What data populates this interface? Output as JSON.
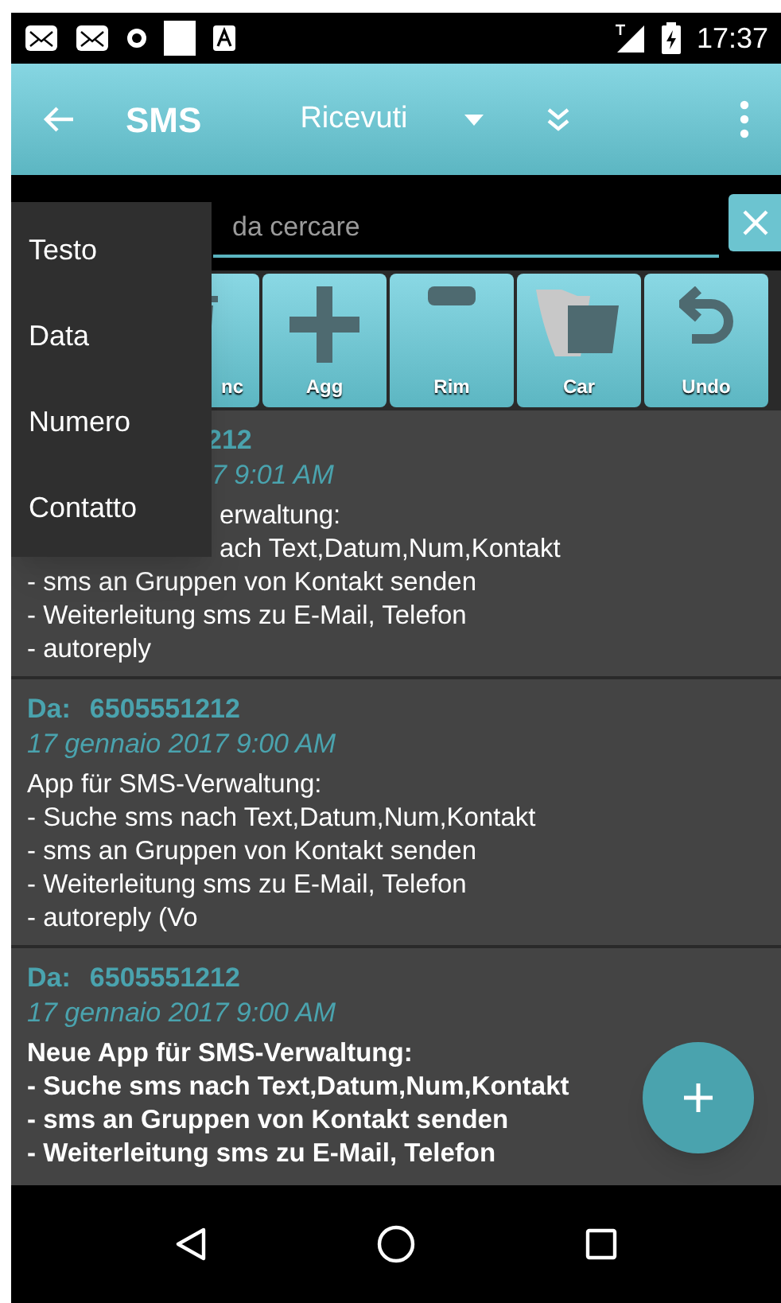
{
  "status_bar": {
    "time": "17:37"
  },
  "app_bar": {
    "title": "SMS",
    "folder": "Ricevuti"
  },
  "search": {
    "placeholder": "da cercare"
  },
  "toolbar": [
    {
      "kind": "delete",
      "label": "nc"
    },
    {
      "kind": "add",
      "label": "Agg"
    },
    {
      "kind": "remove",
      "label": "Rim"
    },
    {
      "kind": "folder",
      "label": "Car"
    },
    {
      "kind": "undo",
      "label": "Undo"
    }
  ],
  "menu": [
    {
      "label": "Testo"
    },
    {
      "label": "Data"
    },
    {
      "label": "Numero"
    },
    {
      "label": "Contatto"
    }
  ],
  "messages": [
    {
      "number_tail": "212",
      "date_tail": "7 9:01 AM",
      "bold": false,
      "tail_lines": [
        "erwaltung:",
        "ach Text,Datum,Num,Kontakt"
      ],
      "lines": [
        "- sms an Gruppen von Kontakt senden",
        "- Weiterleitung sms zu E-Mail, Telefon",
        "- autoreply"
      ]
    },
    {
      "from_label": "Da:",
      "number": "6505551212",
      "date": "17 gennaio 2017 9:00 AM",
      "bold": false,
      "lines": [
        "App für SMS-Verwaltung:",
        "- Suche sms nach Text,Datum,Num,Kontakt",
        "- sms an Gruppen von Kontakt senden",
        "- Weiterleitung sms zu E-Mail, Telefon",
        "- autoreply (Vo"
      ]
    },
    {
      "from_label": "Da:",
      "number": "6505551212",
      "date": "17 gennaio 2017 9:00 AM",
      "bold": true,
      "lines": [
        "Neue App für SMS-Verwaltung:",
        "- Suche sms nach Text,Datum,Num,Kontakt",
        "- sms an Gruppen von Kontakt senden",
        "- Weiterleitung sms zu E-Mail, Telefon"
      ]
    }
  ]
}
